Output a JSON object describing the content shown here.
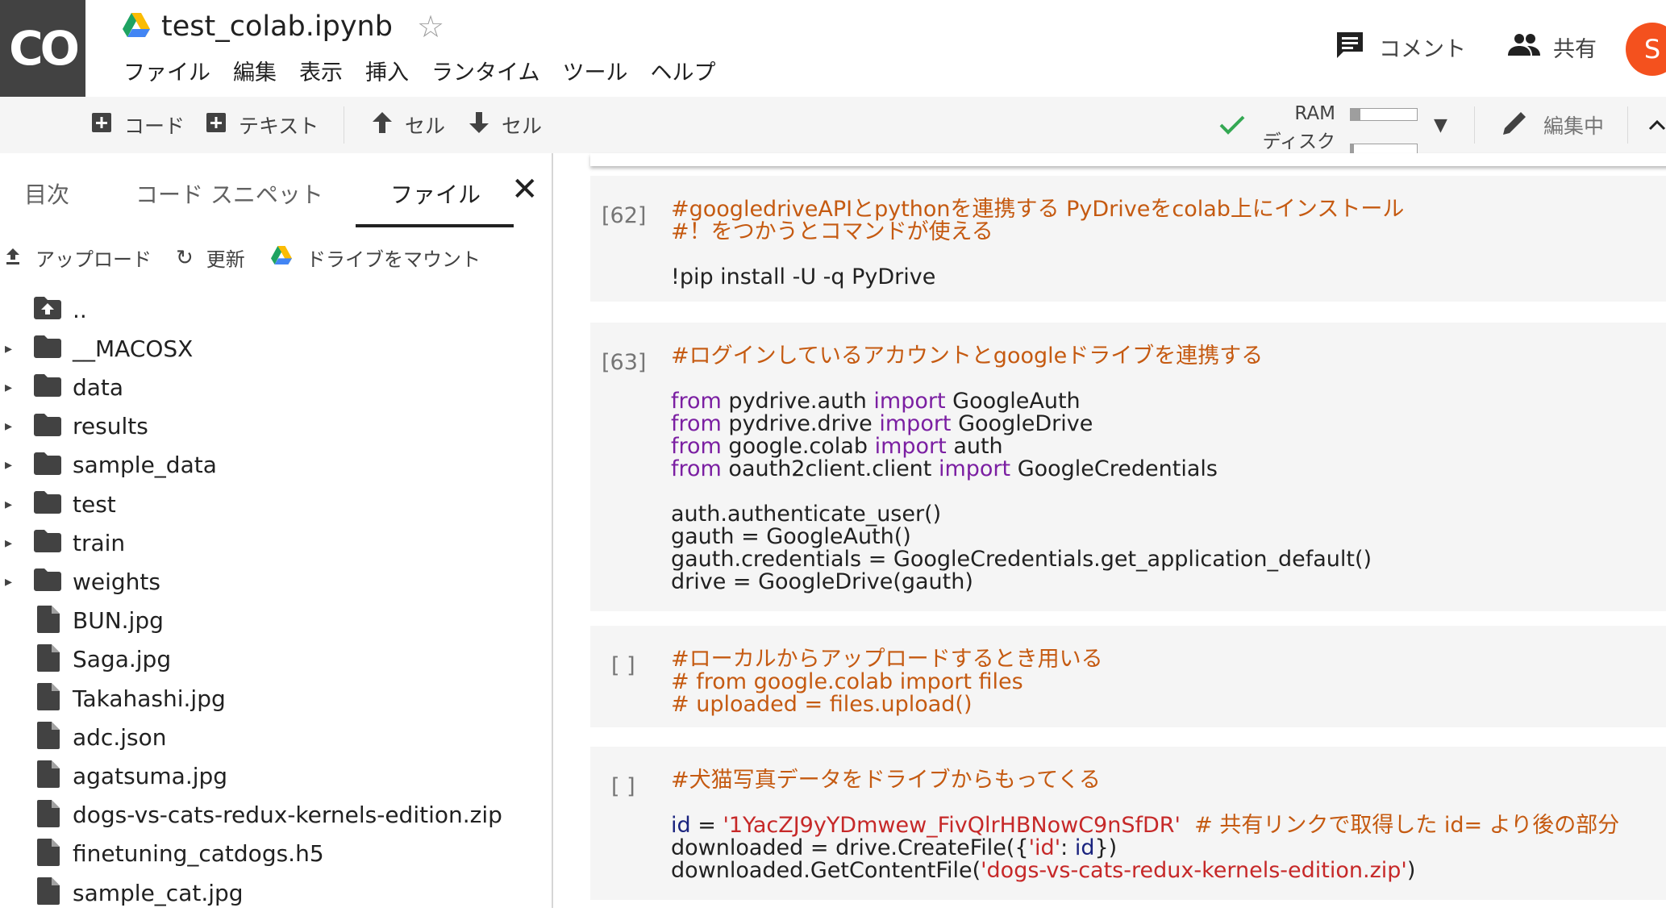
{
  "app": {
    "logo": "CO",
    "notebook_title": "test_colab.ipynb",
    "menu": [
      "ファイル",
      "編集",
      "表示",
      "挿入",
      "ランタイム",
      "ツール",
      "ヘルプ"
    ],
    "comment_label": "コメント",
    "share_label": "共有",
    "avatar_letter": "S",
    "avatar_color": "#f4511e"
  },
  "toolbar": {
    "add_code_label": "コード",
    "add_text_label": "テキスト",
    "cell_up_label": "セル",
    "cell_down_label": "セル",
    "ram_label": "RAM",
    "disk_label": "ディスク",
    "ram_usage_fraction": 0.15,
    "disk_usage_fraction": 0.05,
    "editing_label": "編集中"
  },
  "sidebar": {
    "tabs": [
      "目次",
      "コード スニペット",
      "ファイル"
    ],
    "active_tab": "ファイル",
    "actions": {
      "upload": "アップロード",
      "refresh": "更新",
      "mount": "ドライブをマウント"
    },
    "tree": [
      {
        "name": "..",
        "type": "parent"
      },
      {
        "name": "__MACOSX",
        "type": "folder"
      },
      {
        "name": "data",
        "type": "folder"
      },
      {
        "name": "results",
        "type": "folder"
      },
      {
        "name": "sample_data",
        "type": "folder"
      },
      {
        "name": "test",
        "type": "folder"
      },
      {
        "name": "train",
        "type": "folder"
      },
      {
        "name": "weights",
        "type": "folder"
      },
      {
        "name": "BUN.jpg",
        "type": "file"
      },
      {
        "name": "Saga.jpg",
        "type": "file"
      },
      {
        "name": "Takahashi.jpg",
        "type": "file"
      },
      {
        "name": "adc.json",
        "type": "file"
      },
      {
        "name": "agatsuma.jpg",
        "type": "file"
      },
      {
        "name": "dogs-vs-cats-redux-kernels-edition.zip",
        "type": "file"
      },
      {
        "name": "finetuning_catdogs.h5",
        "type": "file"
      },
      {
        "name": "sample_cat.jpg",
        "type": "file"
      }
    ]
  },
  "cells": [
    {
      "prompt": "[62]",
      "lines": [
        [
          {
            "t": "#googledriveAPIとpythonを連携する PyDriveをcolab上にインストール",
            "c": "cm"
          }
        ],
        [
          {
            "t": "#！をつかうとコマンドが使える",
            "c": "cm"
          }
        ],
        [],
        [
          {
            "t": "!pip install -U -q PyDrive",
            "c": "pl"
          }
        ]
      ]
    },
    {
      "prompt": "[63]",
      "lines": [
        [
          {
            "t": "#ログインしているアカウントとgoogleドライブを連携する",
            "c": "cm"
          }
        ],
        [],
        [
          {
            "t": "from",
            "c": "kw"
          },
          {
            "t": " pydrive.auth ",
            "c": "pl"
          },
          {
            "t": "import",
            "c": "kw"
          },
          {
            "t": " GoogleAuth",
            "c": "pl"
          }
        ],
        [
          {
            "t": "from",
            "c": "kw"
          },
          {
            "t": " pydrive.drive ",
            "c": "pl"
          },
          {
            "t": "import",
            "c": "kw"
          },
          {
            "t": " GoogleDrive",
            "c": "pl"
          }
        ],
        [
          {
            "t": "from",
            "c": "kw"
          },
          {
            "t": " google.colab ",
            "c": "pl"
          },
          {
            "t": "import",
            "c": "kw"
          },
          {
            "t": " auth",
            "c": "pl"
          }
        ],
        [
          {
            "t": "from",
            "c": "kw"
          },
          {
            "t": " oauth2client.client ",
            "c": "pl"
          },
          {
            "t": "import",
            "c": "kw"
          },
          {
            "t": " GoogleCredentials",
            "c": "pl"
          }
        ],
        [],
        [
          {
            "t": "auth.authenticate_user()",
            "c": "pl"
          }
        ],
        [
          {
            "t": "gauth = GoogleAuth()",
            "c": "pl"
          }
        ],
        [
          {
            "t": "gauth.credentials = GoogleCredentials.get_application_default()",
            "c": "pl"
          }
        ],
        [
          {
            "t": "drive = GoogleDrive(gauth)",
            "c": "pl"
          }
        ]
      ]
    },
    {
      "prompt": "[ ]",
      "lines": [
        [
          {
            "t": "#ローカルからアップロードするとき用いる",
            "c": "cm"
          }
        ],
        [
          {
            "t": "# from google.colab import files",
            "c": "cm"
          }
        ],
        [
          {
            "t": "# uploaded = files.upload()",
            "c": "cm"
          }
        ]
      ]
    },
    {
      "prompt": "[ ]",
      "lines": [
        [
          {
            "t": "#犬猫写真データをドライブからもってくる",
            "c": "cm"
          }
        ],
        [],
        [
          {
            "t": "id",
            "c": "id"
          },
          {
            "t": " = ",
            "c": "pl"
          },
          {
            "t": "'1YacZJ9yYDmwew_FivQlrHBNowC9nSfDR'",
            "c": "st"
          },
          {
            "t": "  # 共有リンクで取得した id= より後の部分",
            "c": "cm"
          }
        ],
        [
          {
            "t": "downloaded = drive.CreateFile({",
            "c": "pl"
          },
          {
            "t": "'id'",
            "c": "st"
          },
          {
            "t": ": ",
            "c": "pl"
          },
          {
            "t": "id",
            "c": "id"
          },
          {
            "t": "})",
            "c": "pl"
          }
        ],
        [
          {
            "t": "downloaded.GetContentFile(",
            "c": "pl"
          },
          {
            "t": "'dogs-vs-cats-redux-kernels-edition.zip'",
            "c": "st"
          },
          {
            "t": ")",
            "c": "pl"
          }
        ]
      ]
    }
  ]
}
